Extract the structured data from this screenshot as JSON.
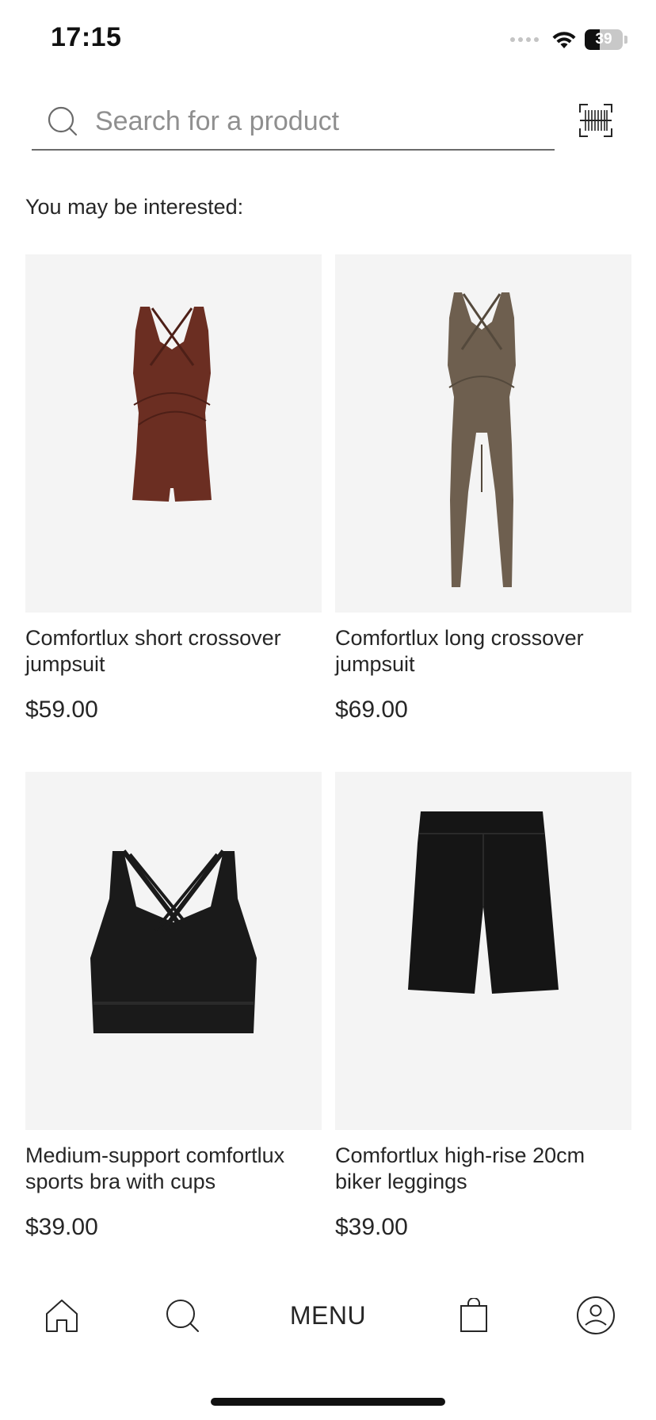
{
  "status_bar": {
    "time": "17:15",
    "battery_level": "39",
    "battery_percent": 39
  },
  "search": {
    "placeholder": "Search for a product",
    "value": ""
  },
  "section": {
    "heading": "You may be interested:"
  },
  "products": [
    {
      "name": "Comfortlux short crossover jumpsuit",
      "price": "$59.00",
      "color": "#6b2e22"
    },
    {
      "name": "Comfortlux long crossover jumpsuit",
      "price": "$69.00",
      "color": "#6e5f4f"
    },
    {
      "name": "Medium-support comfortlux sports bra with cups",
      "price": "$39.00",
      "color": "#1a1a1a"
    },
    {
      "name": "Comfortlux high-rise 20cm biker leggings",
      "price": "$39.00",
      "color": "#151515"
    }
  ],
  "bottom_nav": {
    "menu_label": "MENU",
    "icons": [
      "home-icon",
      "search-icon",
      "shopping-bag-icon",
      "user-icon"
    ]
  },
  "colors": {
    "text": "#262626",
    "image_bg": "#f4f4f4",
    "placeholder": "#8f8f8f"
  }
}
